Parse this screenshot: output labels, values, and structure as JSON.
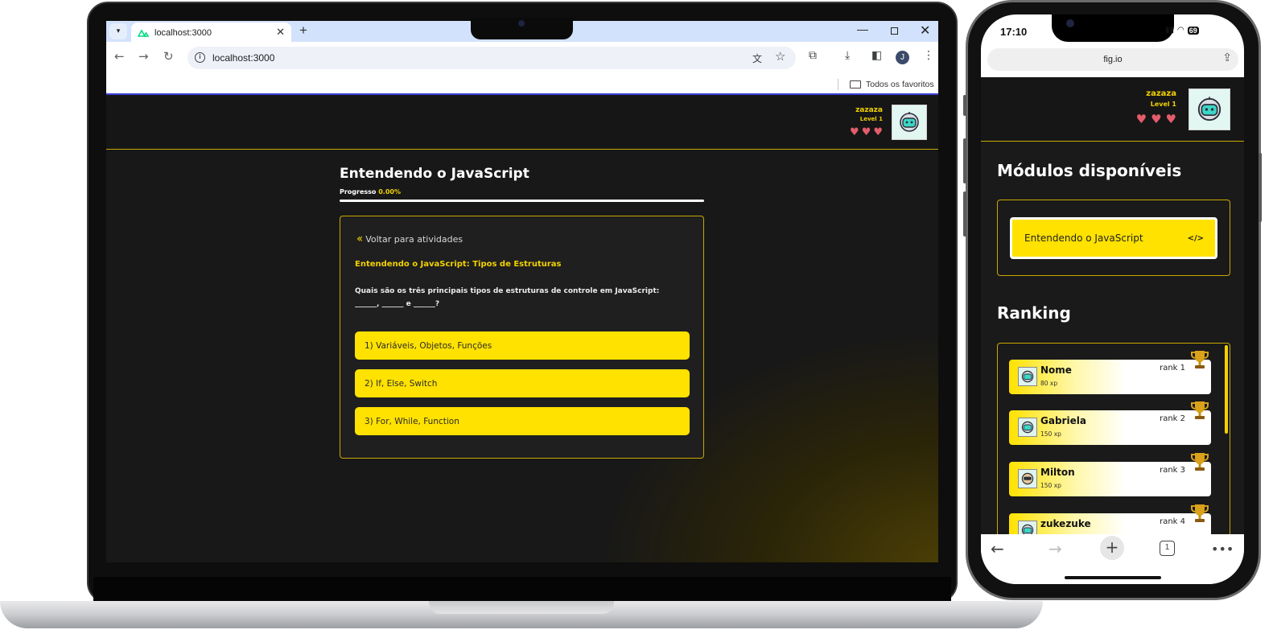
{
  "browser": {
    "tab_title": "localhost:3000",
    "url": "localhost:3000",
    "bookmarks_folder": "Todos os favoritos",
    "profile_initial": "J",
    "tab_close": "✕",
    "new_tab": "+"
  },
  "desktop": {
    "user": {
      "name": "zazaza",
      "level": "Level 1",
      "hearts": 3
    },
    "course": {
      "title": "Entendendo o JavaScript",
      "progress_label": "Progresso",
      "progress_value": "0.00%",
      "progress_fraction": 0
    },
    "activity": {
      "back_label": "Voltar para atividades",
      "title": "Entendendo o JavaScript: Tipos de Estruturas",
      "question": "Quais são os três principais tipos de estruturas de controle em JavaScript:\n______, ______ e ______?",
      "options": [
        "1) Variáveis, Objetos, Funções",
        "2) If, Else, Switch",
        "3) For, While, Function"
      ]
    }
  },
  "phone": {
    "status_time": "17:10",
    "battery": "69",
    "url": "fig.io",
    "user": {
      "name": "zazaza",
      "level": "Level 1",
      "hearts": 3
    },
    "modules_title": "Módulos disponíveis",
    "module_label": "Entendendo o JavaScript",
    "module_icon": "</>",
    "ranking_title": "Ranking",
    "ranking": [
      {
        "name": "Nome",
        "xp": "80 xp",
        "rank": "rank 1"
      },
      {
        "name": "Gabriela",
        "xp": "150 xp",
        "rank": "rank 2"
      },
      {
        "name": "Milton",
        "xp": "150 xp",
        "rank": "rank 3"
      },
      {
        "name": "zukezuke",
        "xp": "",
        "rank": "rank 4"
      }
    ],
    "tab_count": "1"
  },
  "colors": {
    "accent": "#ffe200",
    "accent_text": "#f2d100",
    "background": "#181818",
    "heart": "#e35d6a"
  }
}
